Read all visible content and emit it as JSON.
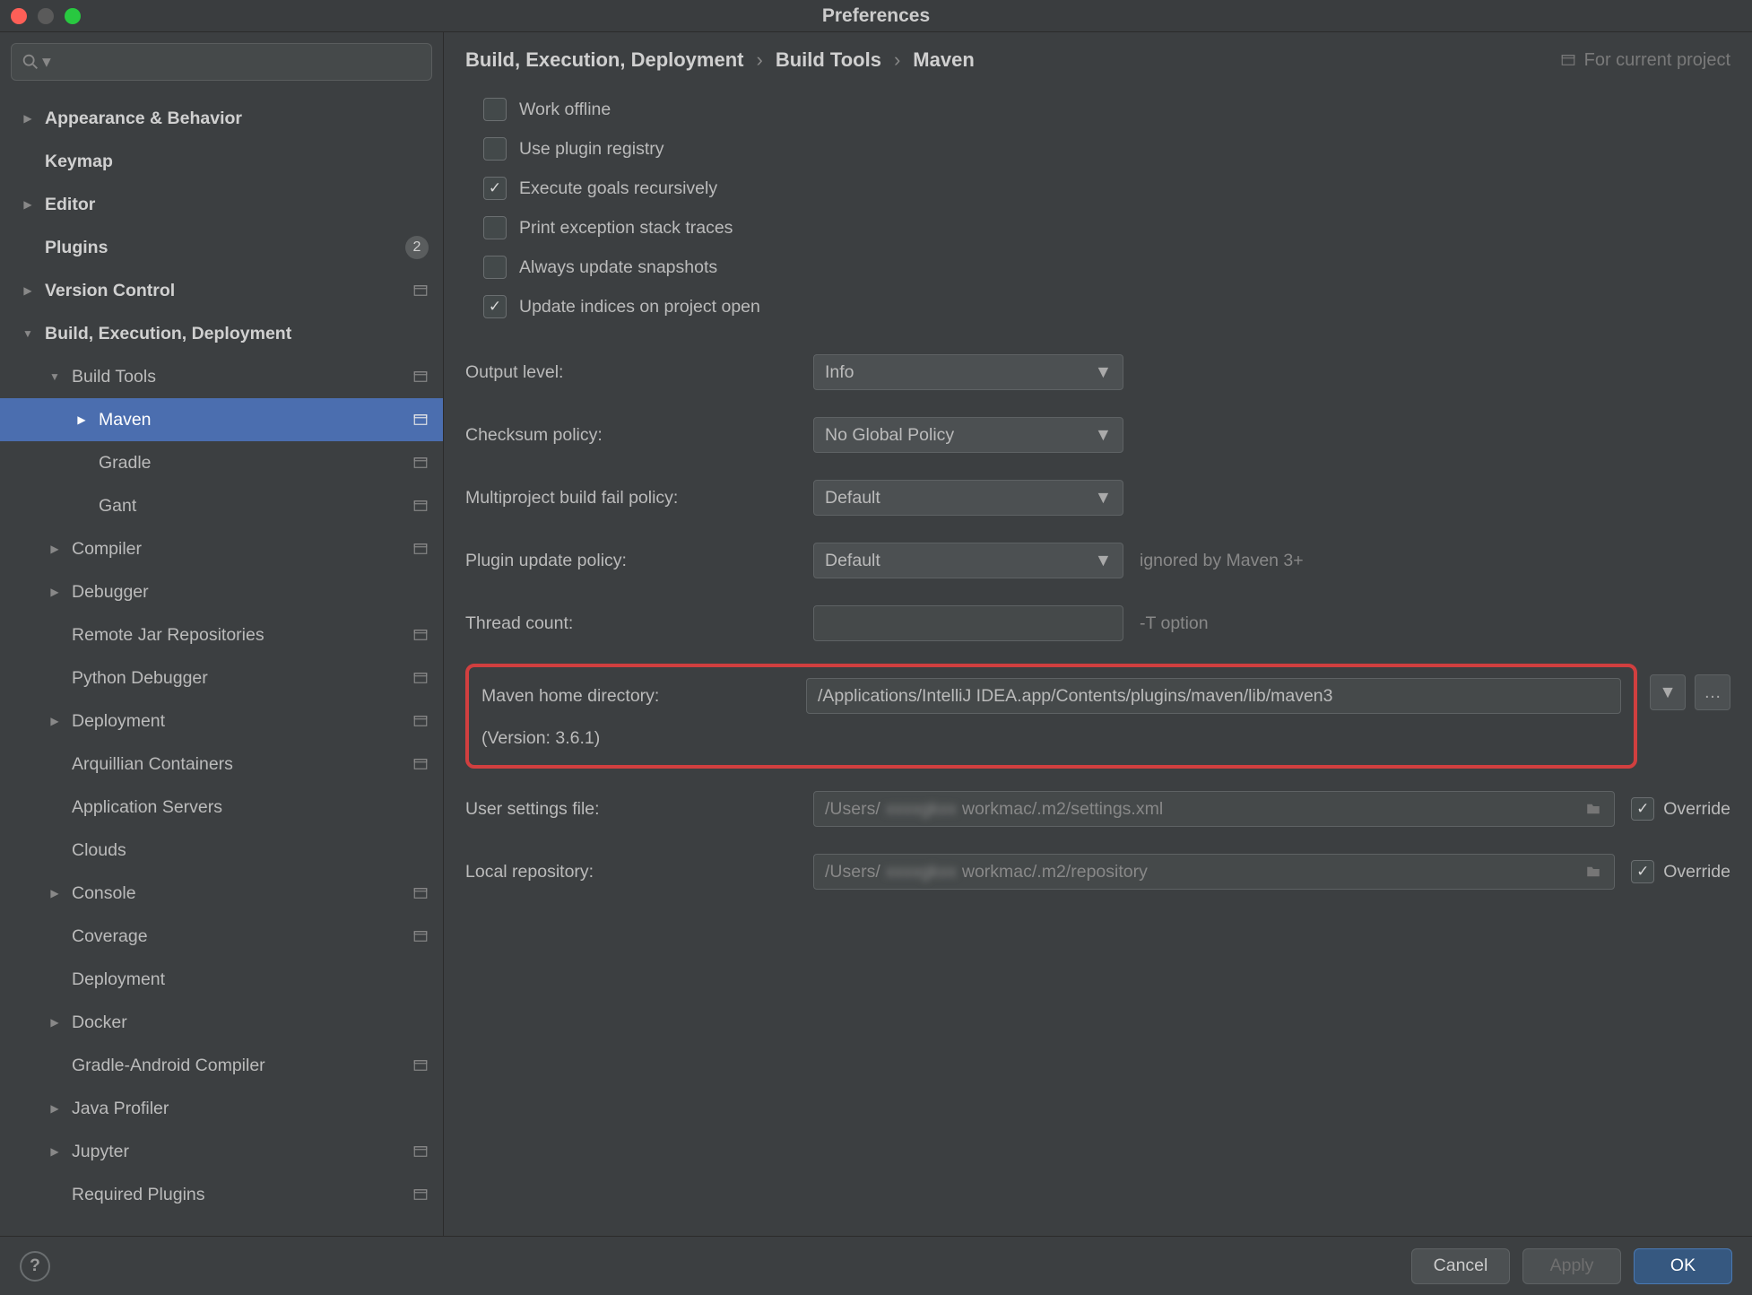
{
  "window": {
    "title": "Preferences"
  },
  "sidebar": {
    "items": [
      {
        "label": "Appearance & Behavior",
        "bold": true,
        "indent": 0,
        "arrow": "right",
        "proj": false
      },
      {
        "label": "Keymap",
        "bold": true,
        "indent": 0,
        "arrow": "none",
        "proj": false
      },
      {
        "label": "Editor",
        "bold": true,
        "indent": 0,
        "arrow": "right",
        "proj": false
      },
      {
        "label": "Plugins",
        "bold": true,
        "indent": 0,
        "arrow": "none",
        "proj": false,
        "badge": "2"
      },
      {
        "label": "Version Control",
        "bold": true,
        "indent": 0,
        "arrow": "right",
        "proj": true
      },
      {
        "label": "Build, Execution, Deployment",
        "bold": true,
        "indent": 0,
        "arrow": "down",
        "proj": false
      },
      {
        "label": "Build Tools",
        "bold": false,
        "indent": 1,
        "arrow": "down",
        "proj": true
      },
      {
        "label": "Maven",
        "bold": false,
        "indent": 2,
        "arrow": "right",
        "proj": true,
        "selected": true
      },
      {
        "label": "Gradle",
        "bold": false,
        "indent": 2,
        "arrow": "none",
        "proj": true
      },
      {
        "label": "Gant",
        "bold": false,
        "indent": 2,
        "arrow": "none",
        "proj": true
      },
      {
        "label": "Compiler",
        "bold": false,
        "indent": 1,
        "arrow": "right",
        "proj": true
      },
      {
        "label": "Debugger",
        "bold": false,
        "indent": 1,
        "arrow": "right",
        "proj": false
      },
      {
        "label": "Remote Jar Repositories",
        "bold": false,
        "indent": 1,
        "arrow": "none",
        "proj": true
      },
      {
        "label": "Python Debugger",
        "bold": false,
        "indent": 1,
        "arrow": "none",
        "proj": true
      },
      {
        "label": "Deployment",
        "bold": false,
        "indent": 1,
        "arrow": "right",
        "proj": true
      },
      {
        "label": "Arquillian Containers",
        "bold": false,
        "indent": 1,
        "arrow": "none",
        "proj": true
      },
      {
        "label": "Application Servers",
        "bold": false,
        "indent": 1,
        "arrow": "none",
        "proj": false
      },
      {
        "label": "Clouds",
        "bold": false,
        "indent": 1,
        "arrow": "none",
        "proj": false
      },
      {
        "label": "Console",
        "bold": false,
        "indent": 1,
        "arrow": "right",
        "proj": true
      },
      {
        "label": "Coverage",
        "bold": false,
        "indent": 1,
        "arrow": "none",
        "proj": true
      },
      {
        "label": "Deployment",
        "bold": false,
        "indent": 1,
        "arrow": "none",
        "proj": false
      },
      {
        "label": "Docker",
        "bold": false,
        "indent": 1,
        "arrow": "right",
        "proj": false
      },
      {
        "label": "Gradle-Android Compiler",
        "bold": false,
        "indent": 1,
        "arrow": "none",
        "proj": true
      },
      {
        "label": "Java Profiler",
        "bold": false,
        "indent": 1,
        "arrow": "right",
        "proj": false
      },
      {
        "label": "Jupyter",
        "bold": false,
        "indent": 1,
        "arrow": "right",
        "proj": true
      },
      {
        "label": "Required Plugins",
        "bold": false,
        "indent": 1,
        "arrow": "none",
        "proj": true
      }
    ]
  },
  "breadcrumb": {
    "items": [
      "Build, Execution, Deployment",
      "Build Tools",
      "Maven"
    ],
    "for_project": "For current project"
  },
  "checks": [
    {
      "label": "Work offline",
      "checked": false
    },
    {
      "label": "Use plugin registry",
      "checked": false
    },
    {
      "label": "Execute goals recursively",
      "checked": true
    },
    {
      "label": "Print exception stack traces",
      "checked": false
    },
    {
      "label": "Always update snapshots",
      "checked": false
    },
    {
      "label": "Update indices on project open",
      "checked": true
    }
  ],
  "selects": {
    "output_level": {
      "label": "Output level:",
      "value": "Info"
    },
    "checksum_policy": {
      "label": "Checksum policy:",
      "value": "No Global Policy"
    },
    "multiproject": {
      "label": "Multiproject build fail policy:",
      "value": "Default"
    },
    "plugin_update": {
      "label": "Plugin update policy:",
      "value": "Default",
      "hint": "ignored by Maven 3+"
    }
  },
  "thread_count": {
    "label": "Thread count:",
    "value": "",
    "hint": "-T option"
  },
  "maven_home": {
    "label": "Maven home directory:",
    "path": "/Applications/IntelliJ IDEA.app/Contents/plugins/maven/lib/maven3",
    "version": "(Version: 3.6.1)"
  },
  "user_settings": {
    "label": "User settings file:",
    "prefix": "/Users/",
    "blur": "xxxxgkxx",
    "suffix": "workmac/.m2/settings.xml",
    "override": "Override",
    "override_checked": true
  },
  "local_repo": {
    "label": "Local repository:",
    "prefix": "/Users/",
    "blur": "xxxxgkxx",
    "suffix": "workmac/.m2/repository",
    "override": "Override",
    "override_checked": true
  },
  "footer": {
    "cancel": "Cancel",
    "apply": "Apply",
    "ok": "OK"
  }
}
